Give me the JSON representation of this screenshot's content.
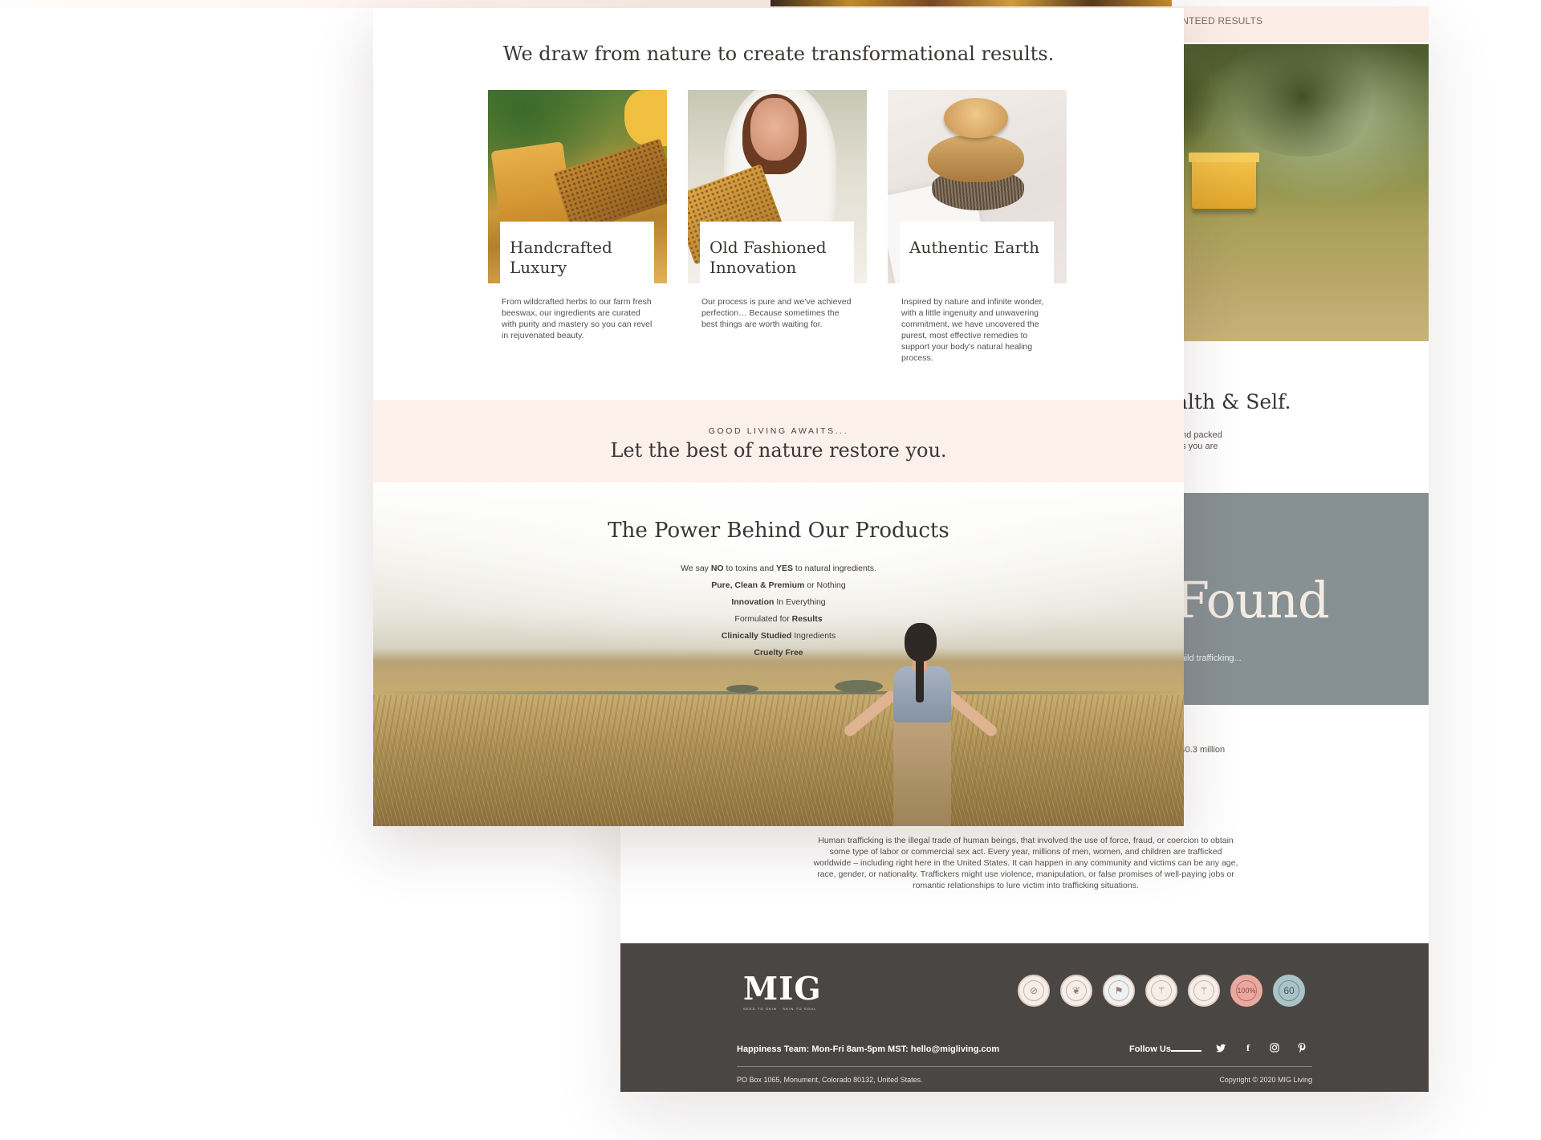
{
  "back": {
    "topbar_text": "ANTEED RESULTS",
    "health_heading": "alth & Self.",
    "health_text_lines": [
      "and packed",
      "as you are"
    ],
    "found_heading": "Found",
    "traff_text": "child trafficking...",
    "million_text": "l 40.3 million",
    "trafficking_paragraph": "Human trafficking is the illegal trade of human beings, that involved the use of force, fraud, or coercion to obtain some type of labor or commercial sex act. Every year, millions of men, women, and children are trafficked worldwide – including right here in the United States. It can happen in any community and victims can be any age, race, gender, or nationality. Traffickers might use violence, manipulation, or false promises of well-paying jobs or romantic relationships to lure victim into trafficking situations."
  },
  "footer": {
    "logo": "MIG",
    "tagline": "SEED TO SKIN · SKIN TO SOUL",
    "badges": [
      {
        "name": "badge-1",
        "glyph": "⊘"
      },
      {
        "name": "badge-2",
        "glyph": "❦"
      },
      {
        "name": "badge-3",
        "glyph": "⚑"
      },
      {
        "name": "badge-4",
        "glyph": "⚚"
      },
      {
        "name": "badge-5",
        "glyph": "⚚"
      },
      {
        "name": "badge-6",
        "glyph": "100%"
      },
      {
        "name": "badge-7",
        "glyph": "60"
      }
    ],
    "happiness": "Happiness Team: Mon-Fri 8am-5pm MST: hello@migliving.com",
    "follow_us": "Follow Us",
    "address": "PO Box 1065, Monument, Colorado 80132, United States.",
    "copyright": "Copyright © 2020 MIG Living",
    "colors": {
      "footer_bg": "#4a4644",
      "badge_pink": "#e9a9a0",
      "badge_blue": "#a9c3c6"
    }
  },
  "front": {
    "heading": "We draw from nature to create transformational results.",
    "cards": [
      {
        "title": "Handcrafted Luxury",
        "desc": "From wildcrafted herbs to our farm fresh beeswax, our ingredients are curated with purity and mastery so you can revel in rejuvenated beauty."
      },
      {
        "title": "Old Fashioned Innovation",
        "desc": "Our process is pure and we've achieved perfection… Because sometimes the best things are worth waiting for."
      },
      {
        "title": "Authentic Earth",
        "desc": "Inspired by nature and infinite wonder, with a little ingenuity and unwavering commitment, we have uncovered the purest, most effective remedies to support your body's natural healing process."
      }
    ],
    "band": {
      "kicker": "GOOD LIVING AWAITS...",
      "title": "Let the best of nature restore you."
    },
    "power": {
      "title": "The Power Behind Our Products",
      "lines": [
        [
          "We say ",
          "NO",
          " to toxins and ",
          "YES",
          " to natural ingredients."
        ],
        [
          "",
          "Pure, Clean & Premium",
          " or Nothing"
        ],
        [
          "",
          "Innovation",
          " In Everything"
        ],
        [
          "Formulated for ",
          "Results",
          ""
        ],
        [
          "",
          "Clinically Studied",
          " Ingredients"
        ],
        [
          "",
          "Cruelty Free",
          ""
        ]
      ]
    }
  },
  "colors": {
    "blush": "#fcf0eb",
    "grey_panel": "#879093",
    "text_dark": "#3a3633"
  }
}
